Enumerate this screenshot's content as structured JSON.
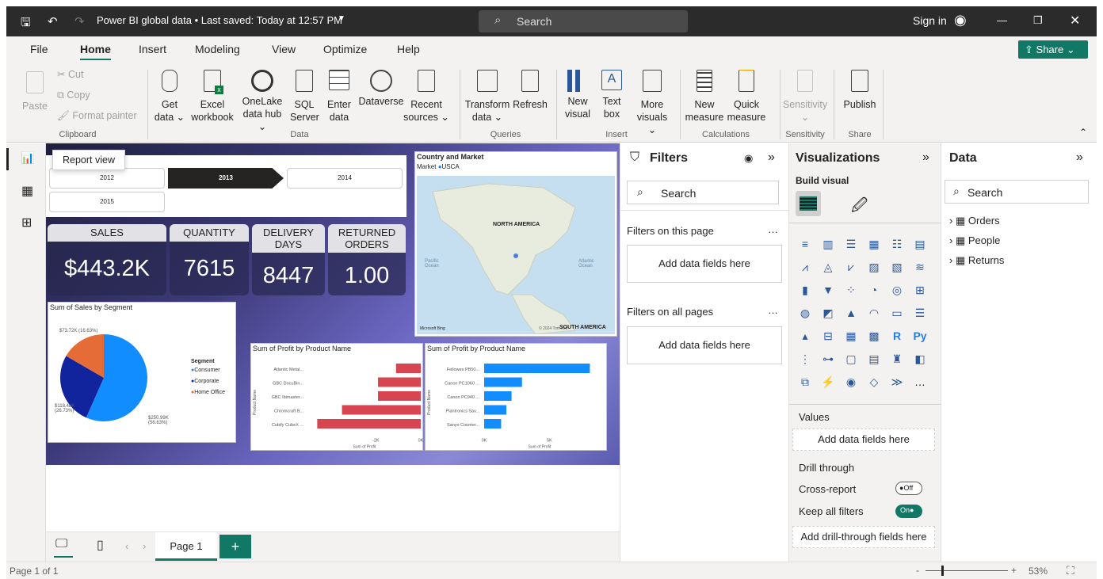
{
  "titlebar": {
    "title": "Power BI global data • Last saved: Today at 12:57 PM",
    "search": "Search",
    "signin": "Sign in"
  },
  "menu": [
    "File",
    "Home",
    "Insert",
    "Modeling",
    "View",
    "Optimize",
    "Help"
  ],
  "share": "Share",
  "ribbon": {
    "clipboard": {
      "paste": "Paste",
      "cut": "Cut",
      "copy": "Copy",
      "format_painter": "Format painter",
      "group": "Clipboard"
    },
    "data": {
      "get_data": [
        "Get",
        "data"
      ],
      "excel": [
        "Excel",
        "workbook"
      ],
      "onelake": [
        "OneLake",
        "data hub"
      ],
      "sql": [
        "SQL",
        "Server"
      ],
      "enter": [
        "Enter",
        "data"
      ],
      "dataverse": "Dataverse",
      "recent": [
        "Recent",
        "sources"
      ],
      "group": "Data"
    },
    "queries": {
      "transform": [
        "Transform",
        "data"
      ],
      "refresh": "Refresh",
      "group": "Queries"
    },
    "insert": {
      "new_visual": [
        "New",
        "visual"
      ],
      "text_box": [
        "Text",
        "box"
      ],
      "more_visuals": [
        "More",
        "visuals"
      ],
      "group": "Insert"
    },
    "calculations": {
      "new_measure": [
        "New",
        "measure"
      ],
      "quick_measure": [
        "Quick",
        "measure"
      ],
      "group": "Calculations"
    },
    "sensitivity": {
      "label": "Sensitivity",
      "group": "Sensitivity"
    },
    "share": {
      "publish": "Publish",
      "group": "Share"
    }
  },
  "tooltip": "Report view",
  "slicer": {
    "years": [
      "2012",
      "2013",
      "2014",
      "2015"
    ],
    "selected": "2013"
  },
  "kpis": [
    {
      "label": "SALES",
      "value": "$443.2K"
    },
    {
      "label": "QUANTITY",
      "value": "7615"
    },
    {
      "label": "DELIVERY DAYS",
      "value": "8447"
    },
    {
      "label": "RETURNED ORDERS",
      "value": "1.00"
    }
  ],
  "map": {
    "title": "Country and Market",
    "legend_label": "Market",
    "legend_item": "USCA",
    "north_america": "NORTH AMERICA",
    "south_america": "SOUTH AMERICA",
    "pacific": "Pacific Ocean",
    "atlantic": "Atlantic Ocean",
    "attribution": "Microsoft Bing",
    "copyright": "© 2024 TomTom"
  },
  "pie": {
    "title": "Sum of Sales by Segment",
    "legend_title": "Segment",
    "legend": [
      "Consumer",
      "Corporate",
      "Home Office"
    ],
    "labels": [
      "$73.72K (16.63%)",
      "$118.48K (26.73%)",
      "$250.99K (56.63%)"
    ]
  },
  "chart_data": [
    {
      "type": "pie",
      "title": "Sum of Sales by Segment",
      "categories": [
        "Consumer",
        "Corporate",
        "Home Office"
      ],
      "values": [
        250.99,
        118.48,
        73.72
      ],
      "colors": [
        "#118dff",
        "#12239e",
        "#e66c37"
      ]
    },
    {
      "type": "bar",
      "orientation": "horizontal",
      "title": "Sum of Profit by Product Name",
      "categories": [
        "Atlantic Metal...",
        "GBC DocuBin...",
        "GBC Ibimaster...",
        "Chromcraft B...",
        "Cubify CubeX ..."
      ],
      "values": [
        -1100,
        -1900,
        -1900,
        -3500,
        -4600
      ],
      "xlim": [
        -5000,
        0
      ],
      "ticks": [
        "-2K",
        "0K"
      ],
      "xlabel": "Sum of Profit",
      "ylabel": "Product Name",
      "color": "#d64550"
    },
    {
      "type": "bar",
      "orientation": "horizontal",
      "title": "Sum of Profit by Product Name",
      "categories": [
        "Fellowes PB50...",
        "Canon PC1060 ...",
        "Canon PC940 ...",
        "Plantronics Sav...",
        "Sanyo Counter..."
      ],
      "values": [
        8100,
        2900,
        2100,
        1700,
        1300
      ],
      "xlim": [
        0,
        8500
      ],
      "ticks": [
        "0K",
        "5K"
      ],
      "xlabel": "Sum of Profit",
      "ylabel": "Product Name",
      "color": "#118dff"
    }
  ],
  "filters": {
    "title": "Filters",
    "search": "Search",
    "this_page": "Filters on this page",
    "all_pages": "Filters on all pages",
    "add": "Add data fields here"
  },
  "viz": {
    "title": "Visualizations",
    "build": "Build visual",
    "values": "Values",
    "add_values": "Add data fields here",
    "drill": "Drill through",
    "cross": "Cross-report",
    "off": "Off",
    "keep": "Keep all filters",
    "on": "On",
    "add_drill": "Add drill-through fields here"
  },
  "data": {
    "title": "Data",
    "search": "Search",
    "tables": [
      "Orders",
      "People",
      "Returns"
    ]
  },
  "pages": {
    "tab": "Page 1"
  },
  "status": {
    "page": "Page 1 of 1",
    "zoom": "53%"
  }
}
